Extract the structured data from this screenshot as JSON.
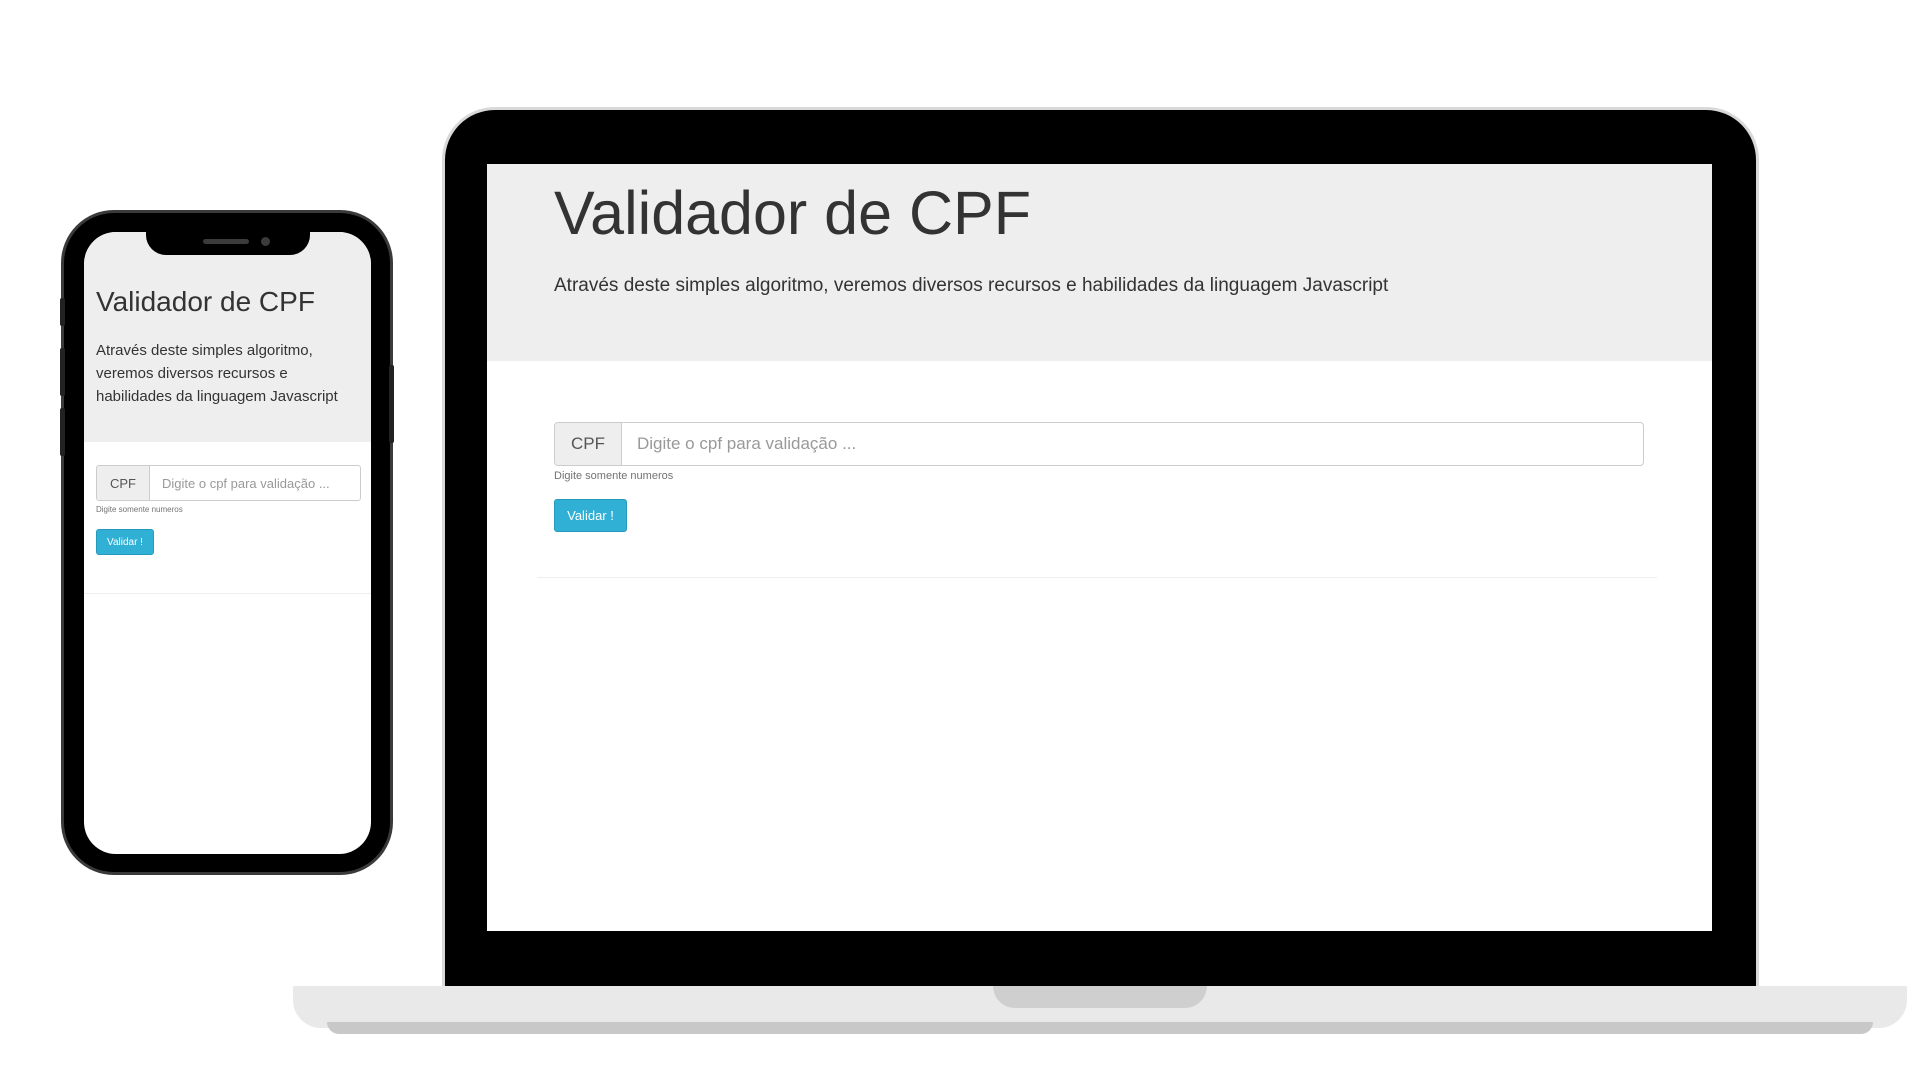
{
  "desktop": {
    "title": "Validador de CPF",
    "lead": "Através deste simples algoritmo, veremos diversos recursos e habilidades da linguagem Javascript",
    "form": {
      "addon_label": "CPF",
      "input_placeholder": "Digite o cpf para validação ...",
      "input_value": "",
      "help_text": "Digite somente numeros",
      "submit_label": "Validar !"
    }
  },
  "mobile": {
    "title": "Validador de CPF",
    "lead": "Através deste simples algoritmo, veremos diversos recursos e habilidades da linguagem Javascript",
    "form": {
      "addon_label": "CPF",
      "input_placeholder": "Digite o cpf para validação ...",
      "input_value": "",
      "help_text": "Digite somente numeros",
      "submit_label": "Validar !"
    }
  },
  "colors": {
    "jumbotron_bg": "#eeeeee",
    "button_info": "#31b0d5",
    "text": "#333333",
    "device_frame": "#000000"
  }
}
